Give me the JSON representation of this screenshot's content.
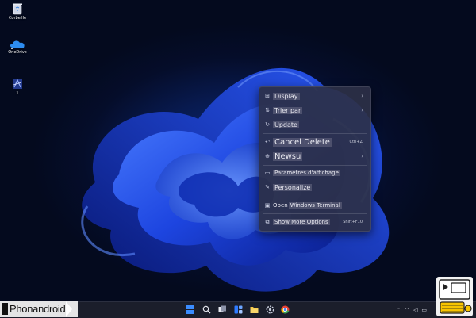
{
  "desktop": {
    "icons": [
      {
        "label": "Corbeille",
        "icon": "recycle-bin-icon"
      },
      {
        "label": "OneDrive",
        "icon": "onedrive-icon"
      },
      {
        "label": "1",
        "icon": "app-shortcut-icon"
      }
    ]
  },
  "context_menu": {
    "items": [
      {
        "label": "Display",
        "icon": "grid-view-icon",
        "arrow": "›"
      },
      {
        "label": "Trier par",
        "icon": "sort-icon",
        "arrow": "›"
      },
      {
        "label": "Update",
        "icon": "refresh-icon"
      },
      {
        "label": "Cancel Delete",
        "icon": "undo-icon",
        "shortcut": "Ctrl+Z"
      },
      {
        "label": "Newsu",
        "icon": "new-icon",
        "arrow": "›"
      },
      {
        "label": "Paramètres d'affichage",
        "icon": "display-settings-icon"
      },
      {
        "label": "Personalize",
        "icon": "paintbrush-icon"
      },
      {
        "label": "Windows Terminal",
        "prefix": "Open",
        "icon": "terminal-icon"
      },
      {
        "label": "Show More Options",
        "icon": "more-options-icon",
        "shortcut": "Shift+F10"
      }
    ]
  },
  "taskbar": {
    "icons": [
      "start-icon",
      "search-icon",
      "task-view-icon",
      "widgets-icon",
      "file-explorer-icon",
      "settings-icon",
      "chrome-icon"
    ],
    "tray": [
      "chevron-up-icon",
      "wifi-icon",
      "volume-icon",
      "battery-icon"
    ]
  },
  "watermark": {
    "text": "Phonandroid"
  },
  "colors": {
    "menu_bg": "#2c3046",
    "accent": "#1f4bff",
    "taskbar": "#1b1e2b"
  }
}
